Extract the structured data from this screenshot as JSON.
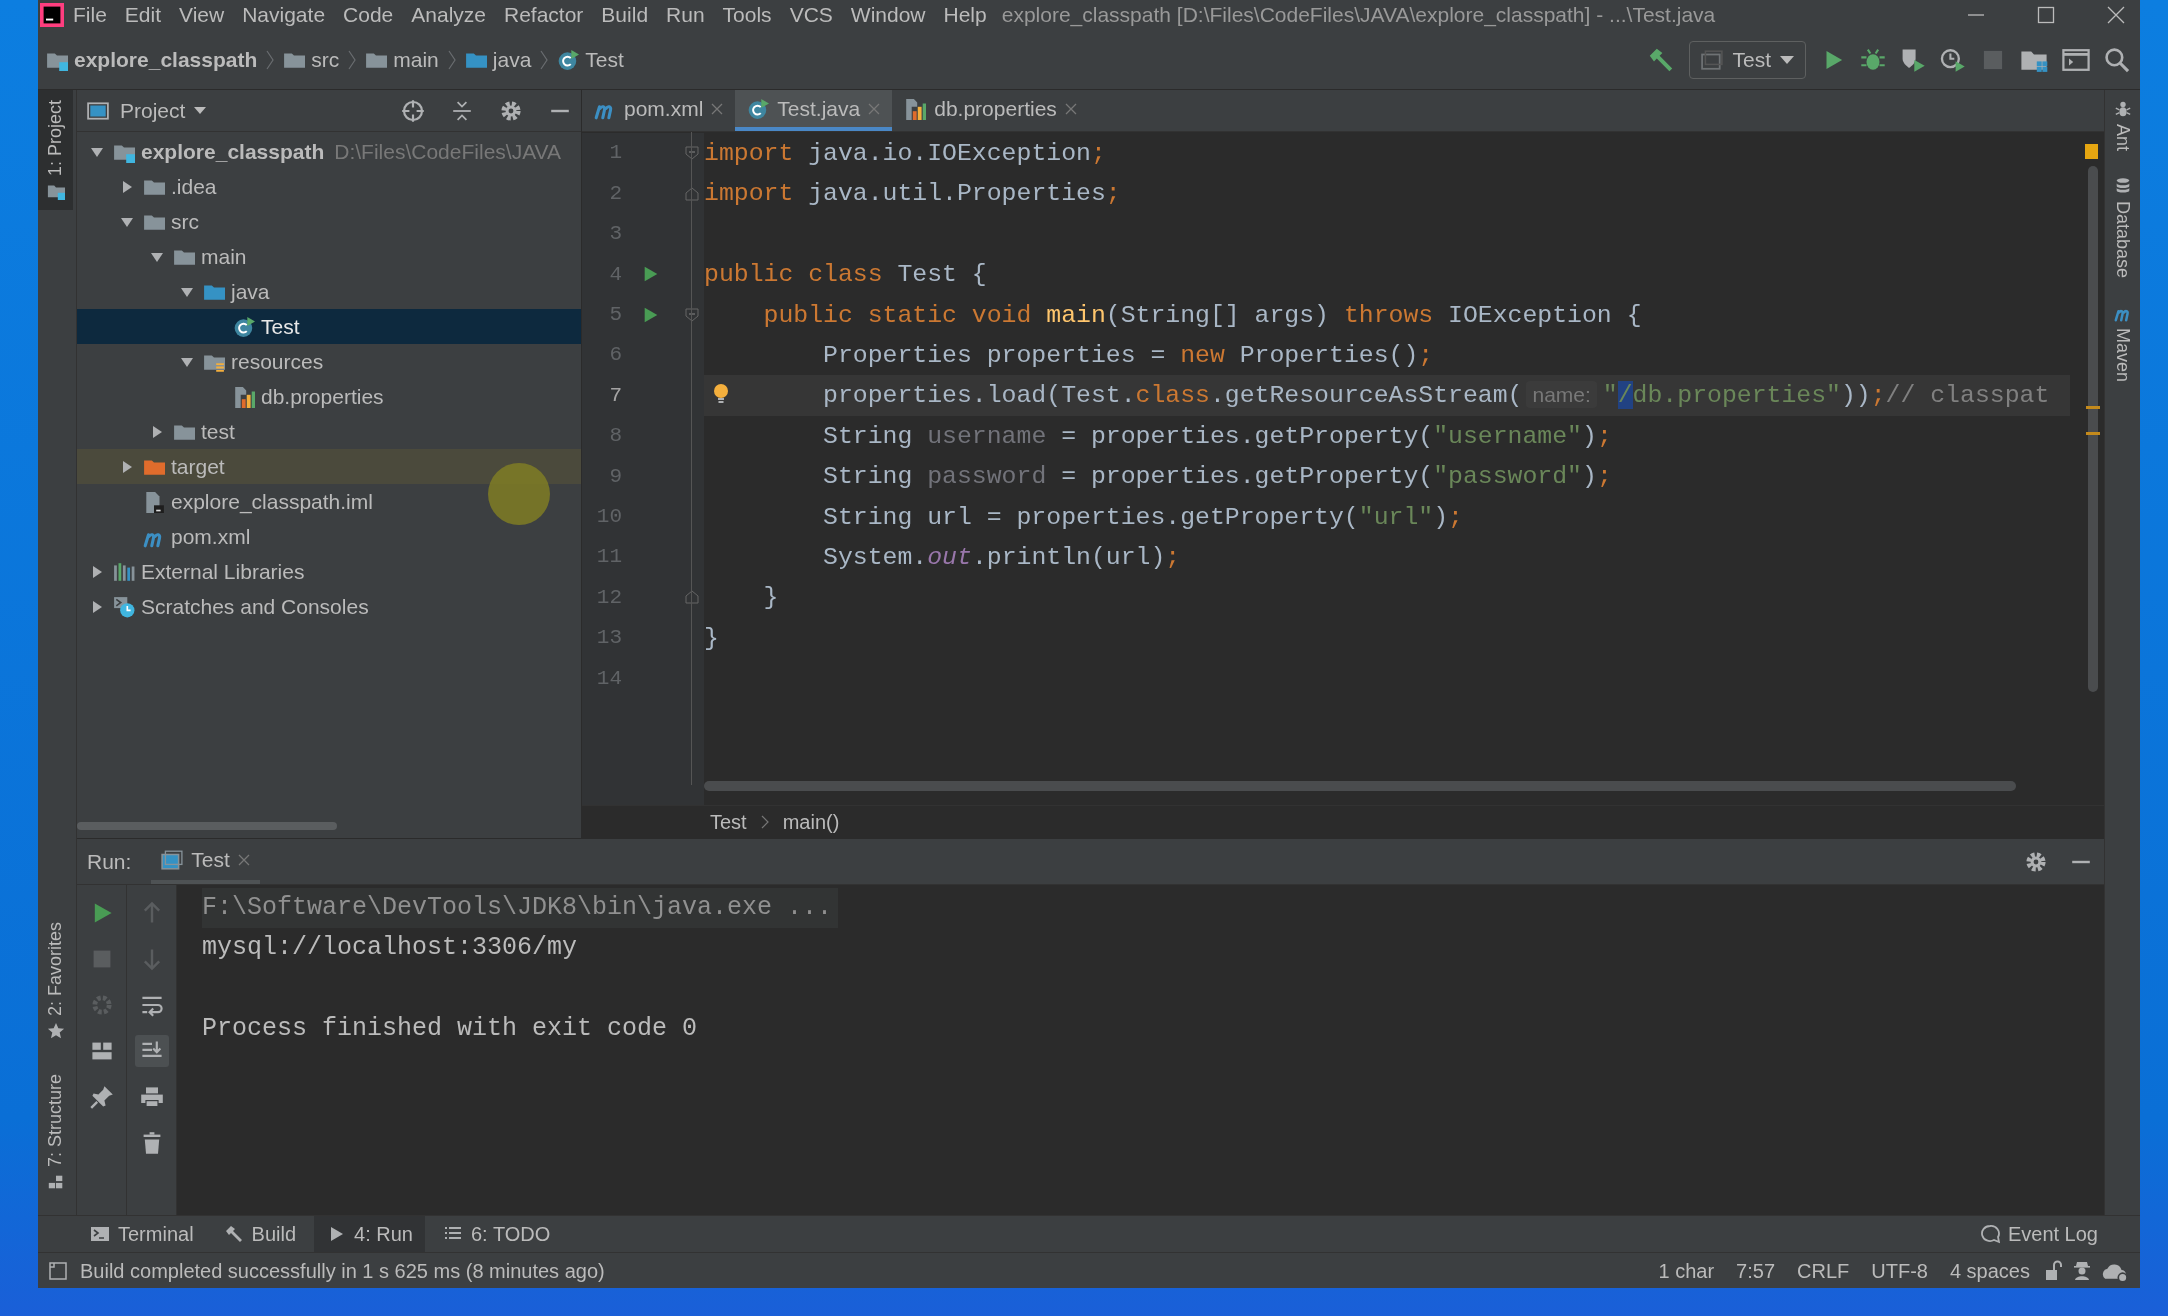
{
  "window": {
    "title": "explore_classpath [D:\\Files\\CodeFiles\\JAVA\\explore_classpath] - ...\\Test.java"
  },
  "menu": [
    "File",
    "Edit",
    "View",
    "Navigate",
    "Code",
    "Analyze",
    "Refactor",
    "Build",
    "Run",
    "Tools",
    "VCS",
    "Window",
    "Help"
  ],
  "breadcrumb": [
    {
      "label": "explore_classpath",
      "kind": "project"
    },
    {
      "label": "src",
      "kind": "folder"
    },
    {
      "label": "main",
      "kind": "folder"
    },
    {
      "label": "java",
      "kind": "source"
    },
    {
      "label": "Test",
      "kind": "class"
    }
  ],
  "run_config": "Test",
  "left_stripe_top": [
    {
      "label": "1: Project",
      "kind": "project",
      "selected": true
    }
  ],
  "left_stripe_bottom": [
    {
      "label": "2: Favorites",
      "kind": "favorites",
      "selected": false
    },
    {
      "label": "7: Structure",
      "kind": "structure",
      "selected": false
    }
  ],
  "right_stripe": [
    {
      "label": "Ant",
      "kind": "ant"
    },
    {
      "label": "Database",
      "kind": "database"
    },
    {
      "label": "Maven",
      "kind": "maven"
    }
  ],
  "project_panel": {
    "title": "Project",
    "tree": [
      {
        "label": "explore_classpath",
        "hint": "D:\\Files\\CodeFiles\\JAVA",
        "kind": "project",
        "expanded": true,
        "selected": false,
        "children": [
          {
            "label": ".idea",
            "kind": "folder",
            "expanded": false,
            "selected": false
          },
          {
            "label": "src",
            "kind": "folder",
            "expanded": true,
            "selected": false,
            "children": [
              {
                "label": "main",
                "kind": "folder",
                "expanded": true,
                "selected": false,
                "children": [
                  {
                    "label": "java",
                    "kind": "source",
                    "expanded": true,
                    "selected": false,
                    "children": [
                      {
                        "label": "Test",
                        "kind": "class",
                        "selected": true
                      }
                    ]
                  },
                  {
                    "label": "resources",
                    "kind": "resources",
                    "expanded": true,
                    "selected": false,
                    "children": [
                      {
                        "label": "db.properties",
                        "kind": "properties",
                        "selected": false
                      }
                    ]
                  }
                ]
              },
              {
                "label": "test",
                "kind": "folder",
                "expanded": false,
                "selected": false
              }
            ]
          },
          {
            "label": "target",
            "kind": "excluded",
            "expanded": false,
            "selected": false,
            "color": "#4b4a3c"
          },
          {
            "label": "explore_classpath.iml",
            "kind": "module",
            "selected": false
          },
          {
            "label": "pom.xml",
            "kind": "maven",
            "selected": false
          }
        ]
      },
      {
        "label": "External Libraries",
        "kind": "libraries",
        "expanded": false,
        "selected": false
      },
      {
        "label": "Scratches and Consoles",
        "kind": "scratches",
        "expanded": false,
        "selected": false
      }
    ]
  },
  "editor_tabs": [
    {
      "label": "pom.xml",
      "kind": "maven",
      "selected": false
    },
    {
      "label": "Test.java",
      "kind": "class",
      "selected": true
    },
    {
      "label": "db.properties",
      "kind": "properties",
      "selected": false
    }
  ],
  "code": [
    {
      "num": "1",
      "current": false,
      "markers": [
        {
          "kind": "fold-start"
        }
      ],
      "tokens": [
        {
          "text": "import",
          "kind": "keyword"
        },
        {
          "text": " java.io.IOException",
          "kind": "plain"
        },
        {
          "text": ";",
          "kind": "keyword"
        }
      ]
    },
    {
      "num": "2",
      "current": false,
      "markers": [
        {
          "kind": "fold-end"
        }
      ],
      "tokens": [
        {
          "text": "import",
          "kind": "keyword"
        },
        {
          "text": " java.util.Properties",
          "kind": "plain"
        },
        {
          "text": ";",
          "kind": "keyword"
        }
      ]
    },
    {
      "num": "3",
      "current": false
    },
    {
      "num": "4",
      "current": false,
      "markers": [
        {
          "kind": "run"
        }
      ],
      "tokens": [
        {
          "text": "public class ",
          "kind": "keyword"
        },
        {
          "text": "Test {",
          "kind": "plain"
        }
      ]
    },
    {
      "num": "5",
      "current": false,
      "markers": [
        {
          "kind": "run"
        },
        {
          "kind": "fold-start"
        }
      ],
      "tokens": [
        {
          "text": "    public static void ",
          "kind": "keyword"
        },
        {
          "text": "main",
          "kind": "method"
        },
        {
          "text": "(String[] args) ",
          "kind": "plain"
        },
        {
          "text": "throws ",
          "kind": "keyword"
        },
        {
          "text": "IOException {",
          "kind": "plain"
        }
      ]
    },
    {
      "num": "6",
      "current": false,
      "tokens": [
        {
          "text": "        Properties properties = ",
          "kind": "plain"
        },
        {
          "text": "new ",
          "kind": "keyword"
        },
        {
          "text": "Properties()",
          "kind": "plain"
        },
        {
          "text": ";",
          "kind": "keyword"
        }
      ]
    },
    {
      "num": "7",
      "current": true,
      "markers": [
        {
          "kind": "bulb"
        }
      ],
      "tokens": [
        {
          "text": "        properties.load(Test.",
          "kind": "plain"
        },
        {
          "text": "class",
          "kind": "keyword"
        },
        {
          "text": ".getResourceAsStream(",
          "kind": "plain"
        },
        {
          "text": "name:",
          "kind": "hint"
        },
        {
          "text": "\"",
          "kind": "string"
        },
        {
          "text": "/",
          "kind": "selection"
        },
        {
          "text": "db.properties\"",
          "kind": "string"
        },
        {
          "text": "))",
          "kind": "plain"
        },
        {
          "text": ";",
          "kind": "keyword"
        },
        {
          "text": "// classpat",
          "kind": "comment"
        }
      ]
    },
    {
      "num": "8",
      "current": false,
      "tokens": [
        {
          "text": "        String ",
          "kind": "plain"
        },
        {
          "text": "username",
          "kind": "unused"
        },
        {
          "text": " = properties.getProperty(",
          "kind": "plain"
        },
        {
          "text": "\"username\"",
          "kind": "string"
        },
        {
          "text": ")",
          "kind": "plain"
        },
        {
          "text": ";",
          "kind": "keyword"
        }
      ]
    },
    {
      "num": "9",
      "current": false,
      "tokens": [
        {
          "text": "        String ",
          "kind": "plain"
        },
        {
          "text": "password",
          "kind": "unused"
        },
        {
          "text": " = properties.getProperty(",
          "kind": "plain"
        },
        {
          "text": "\"password\"",
          "kind": "string"
        },
        {
          "text": ")",
          "kind": "plain"
        },
        {
          "text": ";",
          "kind": "keyword"
        }
      ]
    },
    {
      "num": "10",
      "current": false,
      "tokens": [
        {
          "text": "        String url = properties.getProperty(",
          "kind": "plain"
        },
        {
          "text": "\"url\"",
          "kind": "string"
        },
        {
          "text": ")",
          "kind": "plain"
        },
        {
          "text": ";",
          "kind": "keyword"
        }
      ]
    },
    {
      "num": "11",
      "current": false,
      "tokens": [
        {
          "text": "        System.",
          "kind": "plain"
        },
        {
          "text": "out",
          "kind": "field"
        },
        {
          "text": ".println(url)",
          "kind": "plain"
        },
        {
          "text": ";",
          "kind": "keyword"
        }
      ]
    },
    {
      "num": "12",
      "current": false,
      "markers": [
        {
          "kind": "fold-end"
        }
      ],
      "tokens": [
        {
          "text": "    }",
          "kind": "plain"
        }
      ]
    },
    {
      "num": "13",
      "current": false,
      "tokens": [
        {
          "text": "}",
          "kind": "plain"
        }
      ]
    },
    {
      "num": "14",
      "current": false
    }
  ],
  "code_breadcrumb": [
    "Test",
    "main()"
  ],
  "run_panel": {
    "label": "Run:",
    "tabs": [
      {
        "label": "Test",
        "selected": true
      }
    ],
    "output": [
      {
        "kind": "command",
        "text": "F:\\Software\\DevTools\\JDK8\\bin\\java.exe ..."
      },
      {
        "kind": "stdout",
        "text": "mysql://localhost:3306/my"
      },
      {
        "kind": "blank"
      },
      {
        "kind": "stdout",
        "text": "Process finished with exit code 0"
      }
    ]
  },
  "tool_tabs": [
    {
      "label": "Terminal",
      "kind": "terminal",
      "selected": false
    },
    {
      "label": "Build",
      "kind": "build",
      "selected": false
    },
    {
      "label": "4: Run",
      "kind": "run",
      "selected": true
    },
    {
      "label": "6: TODO",
      "kind": "todo",
      "selected": false
    }
  ],
  "event_log": "Event Log",
  "status_bar": {
    "message": "Build completed successfully in 1 s 625 ms (8 minutes ago)",
    "items": [
      "1 char",
      "7:57",
      "CRLF",
      "UTF-8",
      "4 spaces"
    ]
  }
}
